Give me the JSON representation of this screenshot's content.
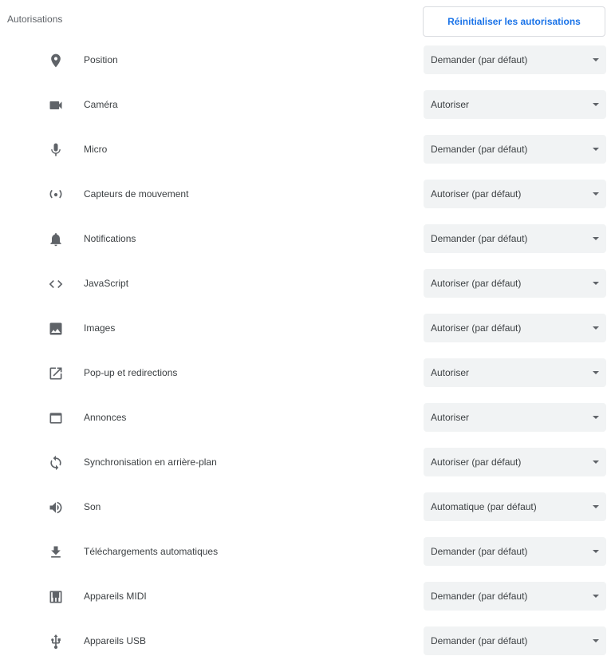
{
  "header": {
    "title": "Autorisations",
    "reset_label": "Réinitialiser les autorisations"
  },
  "permissions": [
    {
      "label": "Position",
      "icon": "location-pin-icon",
      "value": "Demander (par défaut)"
    },
    {
      "label": "Caméra",
      "icon": "camera-icon",
      "value": "Autoriser"
    },
    {
      "label": "Micro",
      "icon": "microphone-icon",
      "value": "Demander (par défaut)"
    },
    {
      "label": "Capteurs de mouvement",
      "icon": "motion-sensor-icon",
      "value": "Autoriser (par défaut)"
    },
    {
      "label": "Notifications",
      "icon": "bell-icon",
      "value": "Demander (par défaut)"
    },
    {
      "label": "JavaScript",
      "icon": "code-icon",
      "value": "Autoriser (par défaut)"
    },
    {
      "label": "Images",
      "icon": "image-icon",
      "value": "Autoriser (par défaut)"
    },
    {
      "label": "Pop-up et redirections",
      "icon": "open-in-new-icon",
      "value": "Autoriser"
    },
    {
      "label": "Annonces",
      "icon": "browser-window-icon",
      "value": "Autoriser"
    },
    {
      "label": "Synchronisation en arrière-plan",
      "icon": "sync-icon",
      "value": "Autoriser (par défaut)"
    },
    {
      "label": "Son",
      "icon": "speaker-icon",
      "value": "Automatique (par défaut)"
    },
    {
      "label": "Téléchargements automatiques",
      "icon": "download-icon",
      "value": "Demander (par défaut)"
    },
    {
      "label": "Appareils MIDI",
      "icon": "piano-keyboard-icon",
      "value": "Demander (par défaut)"
    },
    {
      "label": "Appareils USB",
      "icon": "usb-icon",
      "value": "Demander (par défaut)"
    }
  ]
}
